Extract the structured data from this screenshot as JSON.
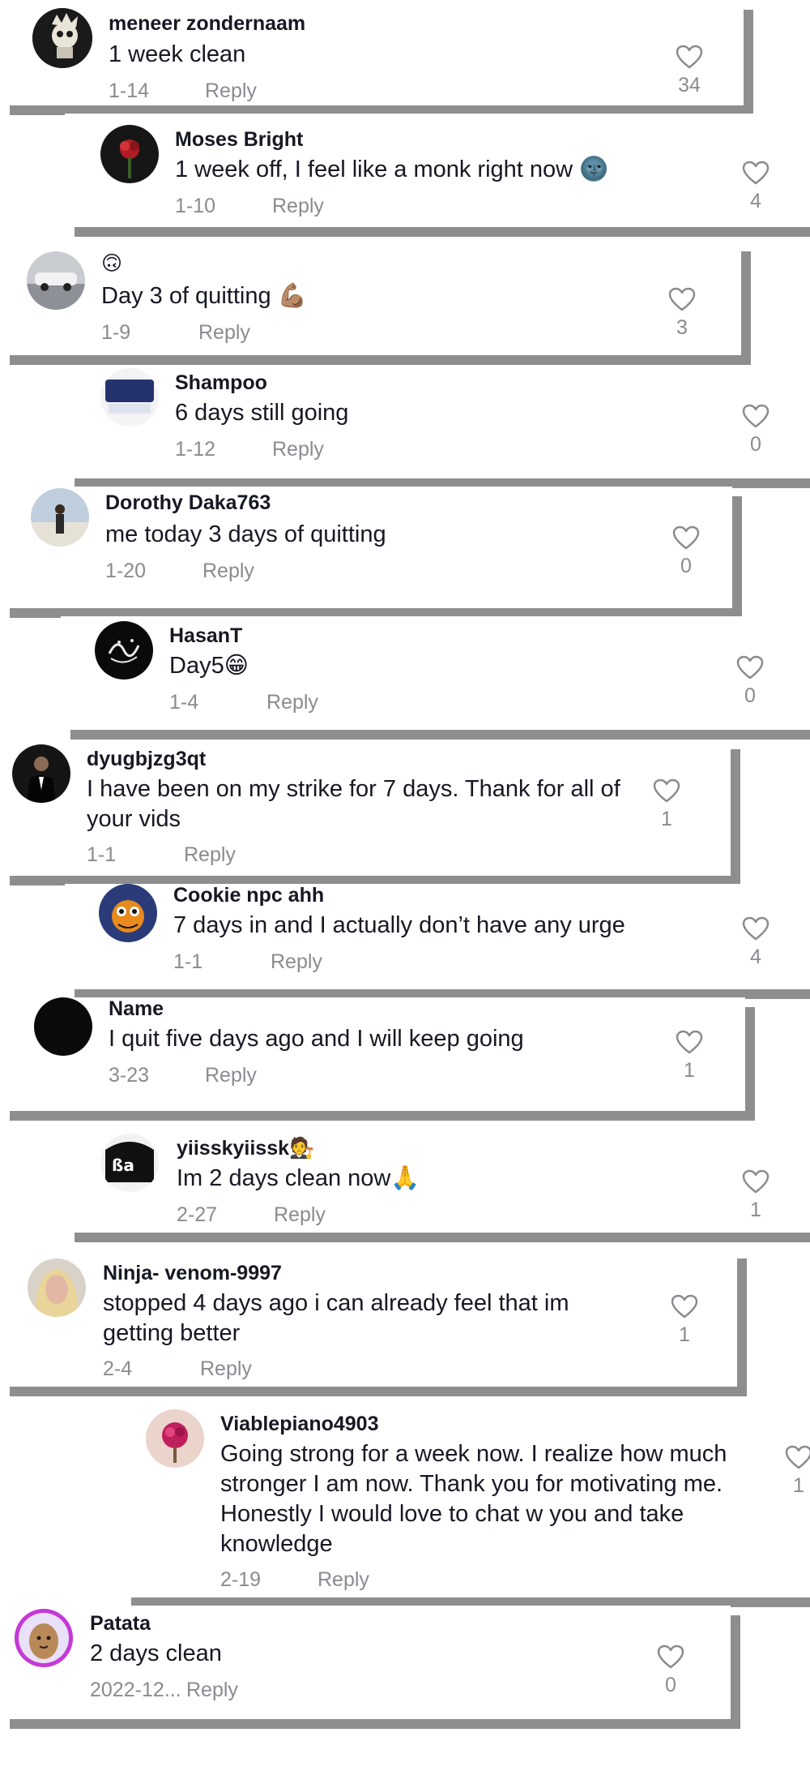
{
  "colors": {
    "shadow": "#8e8e8e",
    "muted": "#8a8b91",
    "text": "#161823"
  },
  "comments": [
    {
      "username": "meneer zondernaam",
      "text": "1 week clean",
      "date": "1-14",
      "reply": "Reply",
      "likes": "34",
      "avatar_icon": "skull-art-avatar"
    },
    {
      "username": "Moses Bright",
      "text": "1 week off, I feel like a monk right now 🌚",
      "date": "1-10",
      "reply": "Reply",
      "likes": "4",
      "avatar_icon": "red-flower-avatar"
    },
    {
      "username": "🙃",
      "text": "Day 3 of quitting 💪🏽",
      "date": "1-9",
      "reply": "Reply",
      "likes": "3",
      "avatar_icon": "car-photo-avatar"
    },
    {
      "username": "Shampoo",
      "text": "6 days still going",
      "date": "1-12",
      "reply": "Reply",
      "likes": "0",
      "avatar_icon": "shampoo-bottle-avatar"
    },
    {
      "username": "Dorothy Daka763",
      "text": "me today 3 days of quitting",
      "date": "1-20",
      "reply": "Reply",
      "likes": "0",
      "avatar_icon": "person-outdoor-avatar"
    },
    {
      "username": "HasanT",
      "text": "Day5😁",
      "date": "1-4",
      "reply": "Reply",
      "likes": "0",
      "avatar_icon": "calligraphy-avatar"
    },
    {
      "username": "dyugbjzg3qt",
      "text_lines": [
        "I have been on my strike for 7 days. Thank for all of",
        "your vids"
      ],
      "date": "1-1",
      "reply": "Reply",
      "likes": "1",
      "avatar_icon": "man-in-suit-avatar"
    },
    {
      "username": "Cookie npc ahh",
      "text": "7 days in and I actually don’t have any urge",
      "date": "1-1",
      "reply": "Reply",
      "likes": "4",
      "avatar_icon": "cartoon-character-avatar"
    },
    {
      "username": "Name",
      "text": "I quit five days ago and I will keep going",
      "date": "3-23",
      "reply": "Reply",
      "likes": "1",
      "avatar_icon": "black-circle-avatar"
    },
    {
      "username": "yiisskyiissk🧑‍⚖️",
      "text": "Im 2 days clean now🙏",
      "date": "2-27",
      "reply": "Reply",
      "likes": "1",
      "avatar_icon": "graffiti-avatar"
    },
    {
      "username": "Ninja- venom-9997",
      "text_lines": [
        "stopped 4 days ago i can already feel that im",
        "getting better"
      ],
      "date": "2-4",
      "reply": "Reply",
      "likes": "1",
      "avatar_icon": "blonde-person-avatar"
    },
    {
      "username": "Viablepiano4903",
      "text_lines": [
        "Going strong for a week now. I realize how much",
        "stronger I am now. Thank you for motivating me.",
        "Honestly I would love to chat w you and take",
        "knowledge"
      ],
      "date": "2-19",
      "reply": "Reply",
      "likes": "1",
      "avatar_icon": "pink-flower-avatar"
    },
    {
      "username": "Patata",
      "text": "2 days clean",
      "date": "2022-12...",
      "reply": "Reply",
      "likes": "0",
      "avatar_icon": "potato-avatar"
    }
  ]
}
